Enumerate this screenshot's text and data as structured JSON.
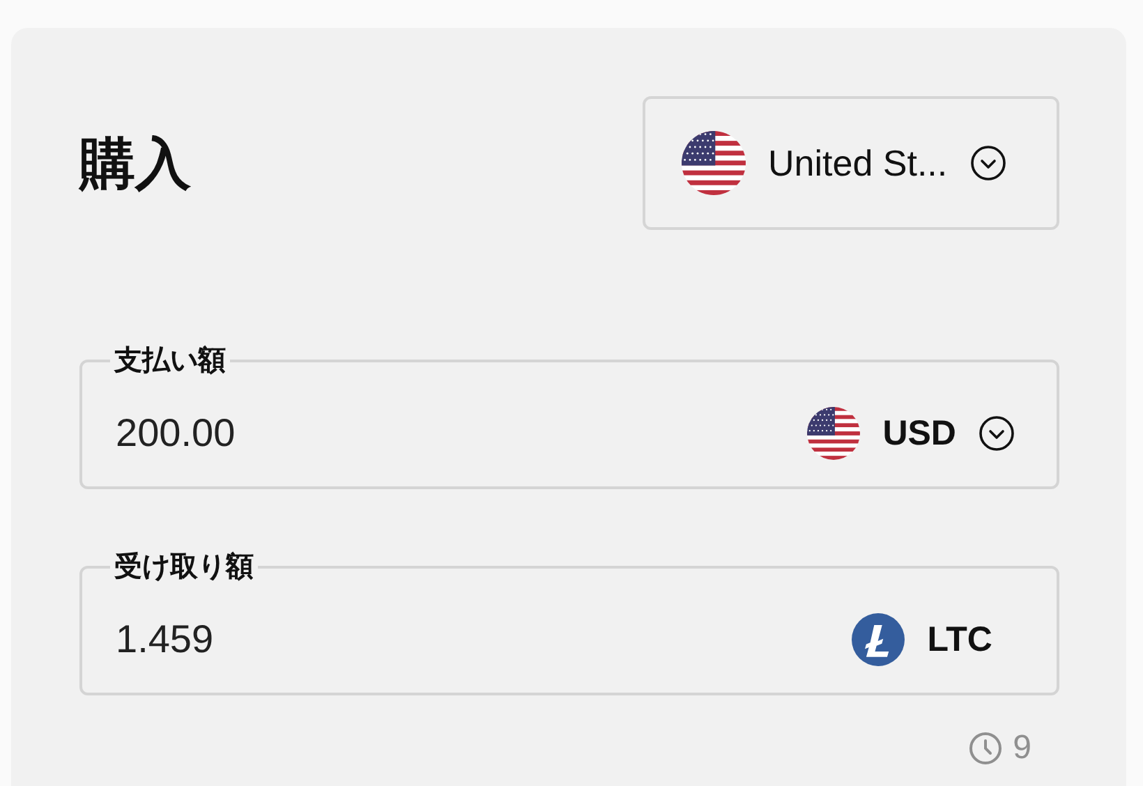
{
  "title": "購入",
  "country": {
    "label": "United St..."
  },
  "fields": [
    {
      "label": "支払い額",
      "value": "200.00",
      "currency": "USD",
      "kind": "flag",
      "dropdown": true
    },
    {
      "label": "受け取り額",
      "value": "1.459",
      "currency": "LTC",
      "kind": "coin",
      "dropdown": false
    }
  ],
  "timer": "9"
}
